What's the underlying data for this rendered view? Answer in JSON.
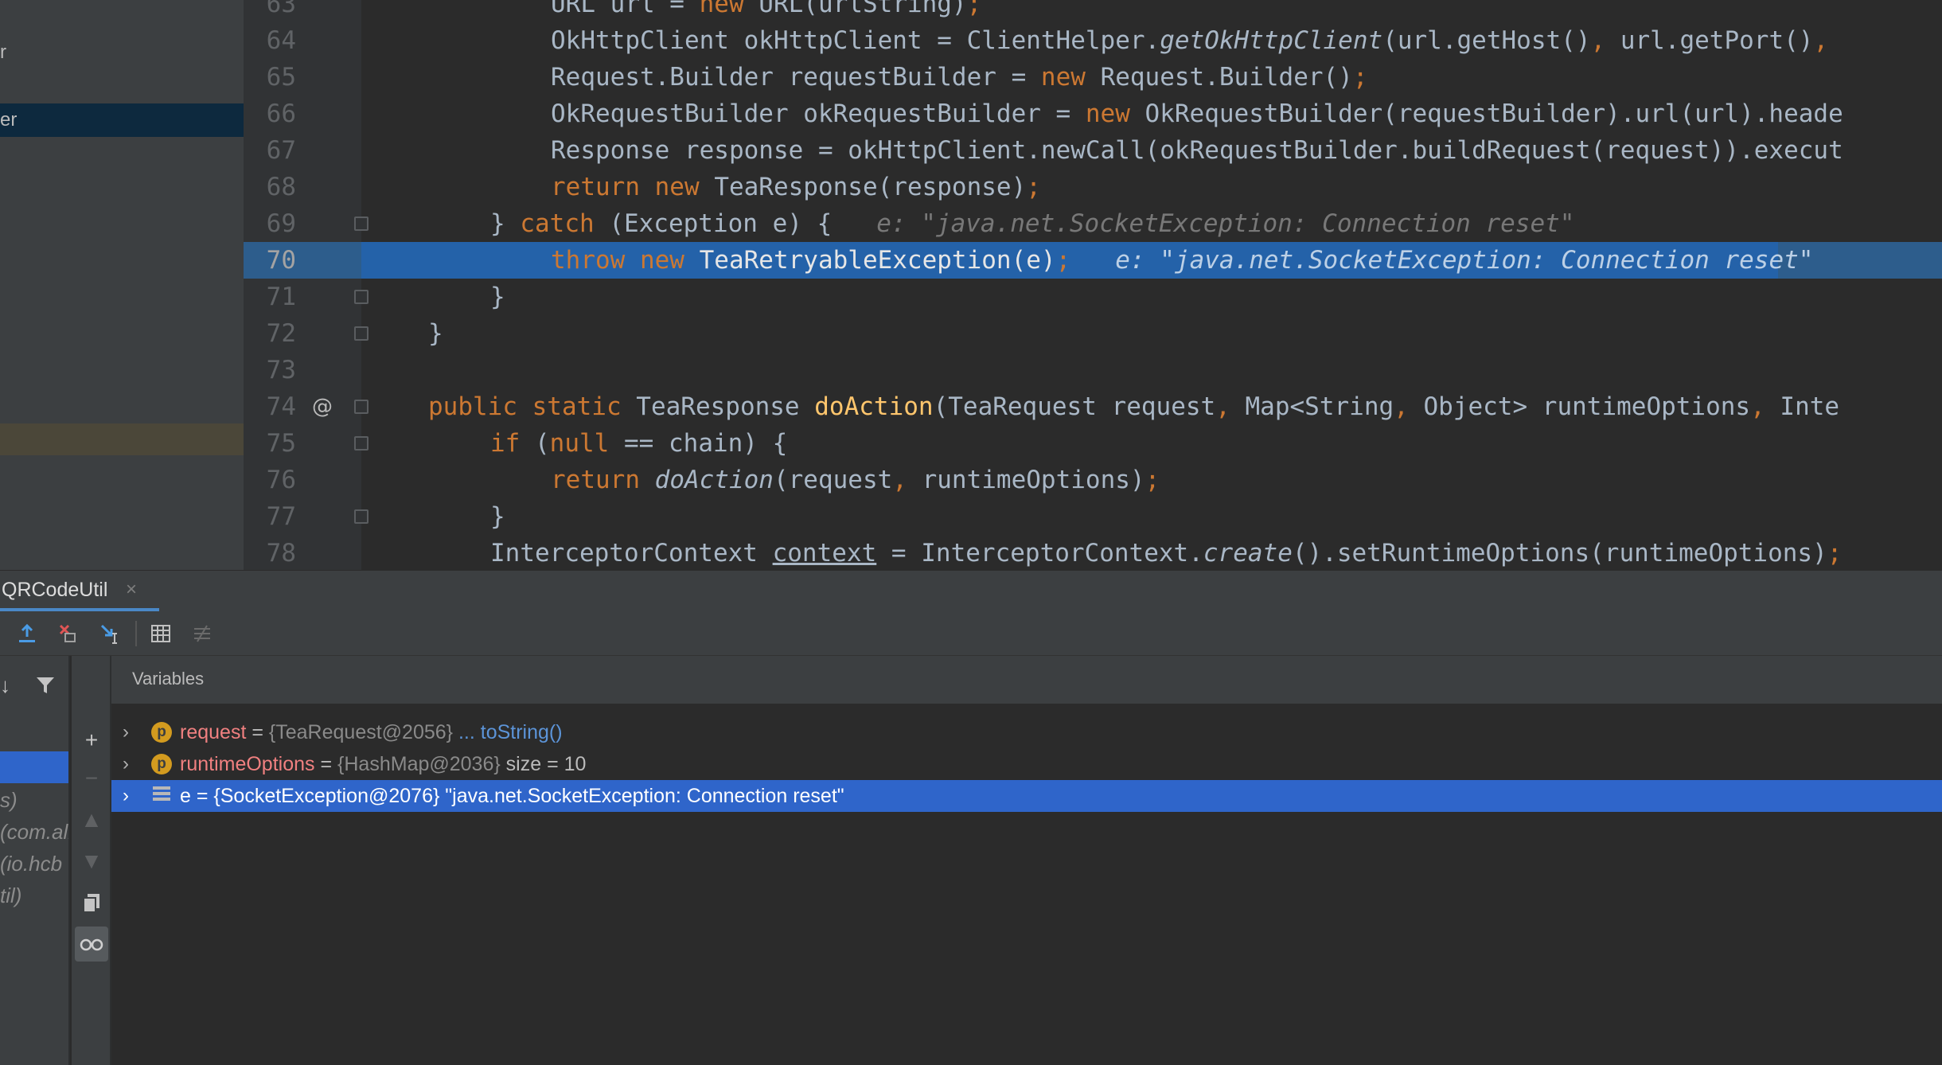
{
  "project_tree": {
    "items": [
      {
        "label": "r"
      },
      {
        "label": "er"
      }
    ]
  },
  "editor": {
    "lines": [
      {
        "num": "63",
        "tokens": [
          [
            "",
            "URL url = "
          ],
          [
            "k",
            "new "
          ],
          [
            "",
            "URL(urlString)"
          ],
          [
            "k",
            ";"
          ]
        ]
      },
      {
        "num": "64",
        "tokens": [
          [
            "",
            "OkHttpClient okHttpClient = ClientHelper."
          ],
          [
            "it",
            "getOkHttpClient"
          ],
          [
            "",
            "(url.getHost()"
          ],
          [
            "k",
            ", "
          ],
          [
            "",
            "url.getPort()"
          ],
          [
            "k",
            ", "
          ]
        ]
      },
      {
        "num": "65",
        "tokens": [
          [
            "",
            "Request.Builder requestBuilder = "
          ],
          [
            "k",
            "new "
          ],
          [
            "",
            "Request.Builder()"
          ],
          [
            "k",
            ";"
          ]
        ]
      },
      {
        "num": "66",
        "tokens": [
          [
            "",
            "OkRequestBuilder okRequestBuilder = "
          ],
          [
            "k",
            "new "
          ],
          [
            "",
            "OkRequestBuilder(requestBuilder).url(url).heade"
          ]
        ]
      },
      {
        "num": "67",
        "tokens": [
          [
            "",
            "Response response = okHttpClient.newCall(okRequestBuilder.buildRequest(request)).execut"
          ]
        ]
      },
      {
        "num": "68",
        "tokens": [
          [
            "k",
            "return new "
          ],
          [
            "",
            "TeaResponse(response)"
          ],
          [
            "k",
            ";"
          ]
        ]
      },
      {
        "num": "69",
        "tokens": [
          [
            "",
            "} "
          ],
          [
            "k",
            "catch "
          ],
          [
            "",
            "(Exception e) {   "
          ],
          [
            "hint",
            "e: \"java.net.SocketException: Connection reset\""
          ]
        ]
      },
      {
        "num": "70",
        "tokens": [
          [
            "k",
            "throw new "
          ],
          [
            "",
            "TeaRetryableException(e)"
          ],
          [
            "k",
            ";"
          ],
          [
            "",
            "   "
          ],
          [
            "hint",
            "e: \"java.net.SocketException: Connection reset\""
          ]
        ]
      },
      {
        "num": "71",
        "tokens": [
          [
            "",
            "}"
          ]
        ]
      },
      {
        "num": "72",
        "tokens": [
          [
            "",
            "}"
          ]
        ]
      },
      {
        "num": "73",
        "tokens": [
          [
            "",
            ""
          ]
        ]
      },
      {
        "num": "74",
        "tokens": [
          [
            "k",
            "public static "
          ],
          [
            "",
            "TeaResponse "
          ],
          [
            "fn",
            "doAction"
          ],
          [
            "",
            "(TeaRequest request"
          ],
          [
            "k",
            ", "
          ],
          [
            "",
            "Map<String"
          ],
          [
            "k",
            ", "
          ],
          [
            "",
            "Object> runtimeOptions"
          ],
          [
            "k",
            ", "
          ],
          [
            "",
            "Inte"
          ]
        ]
      },
      {
        "num": "75",
        "tokens": [
          [
            "k",
            "if "
          ],
          [
            "",
            "("
          ],
          [
            "k",
            "null "
          ],
          [
            "",
            "== chain) {"
          ]
        ]
      },
      {
        "num": "76",
        "tokens": [
          [
            "k",
            "return "
          ],
          [
            "it",
            "doAction"
          ],
          [
            "",
            "(request"
          ],
          [
            "k",
            ", "
          ],
          [
            "",
            "runtimeOptions)"
          ],
          [
            "k",
            ";"
          ]
        ]
      },
      {
        "num": "77",
        "tokens": [
          [
            "",
            "}"
          ]
        ]
      },
      {
        "num": "78",
        "tokens": [
          [
            "",
            "InterceptorContext "
          ],
          [
            "ul",
            "context"
          ],
          [
            "",
            " = InterceptorContext."
          ],
          [
            "it",
            "create"
          ],
          [
            "",
            "().setRuntimeOptions(runtimeOptions)"
          ],
          [
            "k",
            ";"
          ]
        ]
      }
    ],
    "at_marker": "@"
  },
  "debug": {
    "tab_label": "QRCodeUtil",
    "tab_close": "×",
    "variables_title": "Variables",
    "frames": [
      "s)",
      "(com.ali",
      " (io.hcb",
      "til)"
    ],
    "variables": [
      {
        "name": "request",
        "eq": " = ",
        "type": "{TeaRequest@2056}",
        "link": " ... toString()",
        "value": ""
      },
      {
        "name": "runtimeOptions",
        "eq": " = ",
        "type": "{HashMap@2036}",
        "link": "",
        "value": "  size = 10"
      },
      {
        "name": "e",
        "eq": " = ",
        "type": "{SocketException@2076}",
        "link": "",
        "value": " \"java.net.SocketException: Connection reset\""
      }
    ]
  },
  "colors": {
    "keyword": "#cc7832",
    "method": "#ffc66d",
    "execution_line": "#2462a9",
    "selection": "#2f65ca"
  }
}
